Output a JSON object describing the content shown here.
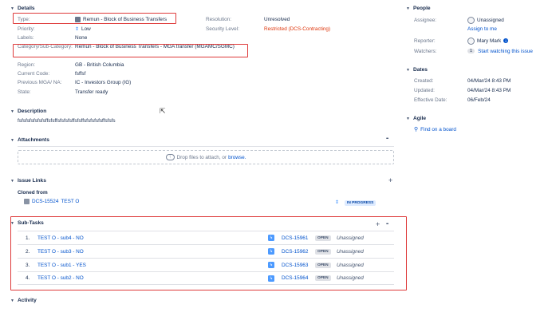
{
  "details": {
    "title": "Details",
    "fields": [
      {
        "label": "Type:",
        "value": "Remun - Block of Business Transfers"
      },
      {
        "label": "Priority:",
        "value": "Low"
      },
      {
        "label": "Labels:",
        "value": "None"
      },
      {
        "label": "Category/Sub-Category:",
        "value": "Remun - Block of Business Transfers - MGA transfer (MGAMC/SGMC)"
      },
      {
        "label": "Region:",
        "value": "GB - British Columbia"
      },
      {
        "label": "Current Code:",
        "value": "fsffsf"
      },
      {
        "label": "Previous MGA/ NA:",
        "value": "IC - Investors Group (IG)"
      },
      {
        "label": "State:",
        "value": "Transfer ready"
      }
    ],
    "right_fields": [
      {
        "label": "Resolution:",
        "value": "Unresolved"
      },
      {
        "label": "Security Level:",
        "value": "Restricted (DCS-Contracting)"
      }
    ]
  },
  "description": {
    "title": "Description",
    "text": "fsfsfsfsfsfsfsffsfsffsfsfsfsffsfsffsfsfsfsfsffsfsfs"
  },
  "attachments": {
    "title": "Attachments",
    "more": "•••",
    "drop_text": "Drop files to attach, or",
    "browse": "browse."
  },
  "issue_links": {
    "title": "Issue Links",
    "add": "+",
    "group": "Cloned from",
    "item": {
      "key": "DCS-15524",
      "summary": "TEST O",
      "status": "IN PROGRESS"
    }
  },
  "subtasks": {
    "title": "Sub-Tasks",
    "add": "+",
    "more": "•••",
    "rows": [
      {
        "num": "1.",
        "summary": "TEST O - sub4 - NO",
        "key": "DCS-15961",
        "status": "OPEN",
        "assignee": "Unassigned"
      },
      {
        "num": "2.",
        "summary": "TEST O - sub3 - NO",
        "key": "DCS-15962",
        "status": "OPEN",
        "assignee": "Unassigned"
      },
      {
        "num": "3.",
        "summary": "TEST O - sub1 - YES",
        "key": "DCS-15963",
        "status": "OPEN",
        "assignee": "Unassigned"
      },
      {
        "num": "4.",
        "summary": "TEST O - sub2 - NO",
        "key": "DCS-15964",
        "status": "OPEN",
        "assignee": "Unassigned"
      }
    ]
  },
  "activity": {
    "title": "Activity"
  },
  "people": {
    "title": "People",
    "assignee_label": "Assignee:",
    "assignee_value": "Unassigned",
    "assign_to_me": "Assign to me",
    "reporter_label": "Reporter:",
    "reporter_value": "Mary Mark",
    "watchers_label": "Watchers:",
    "watchers_count": "1",
    "watch_link": "Start watching this issue"
  },
  "dates": {
    "title": "Dates",
    "created_label": "Created:",
    "created_value": "04/Mar/24 8:43 PM",
    "updated_label": "Updated:",
    "updated_value": "04/Mar/24 8:43 PM",
    "effective_label": "Effective Date:",
    "effective_value": "06/Feb/24"
  },
  "agile": {
    "title": "Agile",
    "link": "Find on a board"
  },
  "colors": {
    "highlight": "#de3a3a",
    "link": "#0052cc",
    "restricted": "#de350b"
  }
}
